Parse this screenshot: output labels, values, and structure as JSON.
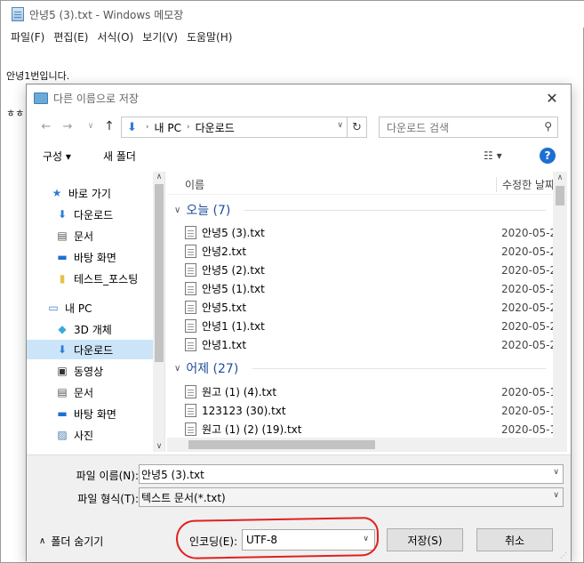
{
  "notepad": {
    "title": "안녕5 (3).txt - Windows 메모장",
    "menu": [
      "파일(F)",
      "편집(E)",
      "서식(O)",
      "보기(V)",
      "도움말(H)"
    ],
    "text_lines": [
      "안녕1번입니다.",
      "ㅎㅎㅎ 반가워요."
    ]
  },
  "dialog": {
    "title": "다른 이름으로 저장",
    "close": "✕",
    "address": {
      "segments": [
        "내 PC",
        "다운로드"
      ]
    },
    "search_placeholder": "다운로드 검색",
    "toolbar": {
      "organize": "구성 ▾",
      "new_folder": "새 폴더",
      "view": "☷ ▾",
      "help": "?"
    },
    "nav_items": [
      {
        "label": "바로 가기",
        "icon": "star-icon"
      },
      {
        "label": "다운로드",
        "icon": "download-icon"
      },
      {
        "label": "문서",
        "icon": "document-icon"
      },
      {
        "label": "바탕 화면",
        "icon": "desktop-icon"
      },
      {
        "label": "테스트_포스팅",
        "icon": "folder-icon"
      },
      {
        "label": "내 PC",
        "icon": "pc-icon"
      },
      {
        "label": "3D 개체",
        "icon": "cube-icon"
      },
      {
        "label": "다운로드",
        "icon": "download-icon",
        "selected": true
      },
      {
        "label": "동영상",
        "icon": "video-icon"
      },
      {
        "label": "문서",
        "icon": "document-icon"
      },
      {
        "label": "바탕 화면",
        "icon": "desktop-icon"
      },
      {
        "label": "사진",
        "icon": "picture-icon"
      }
    ],
    "columns": {
      "name": "이름",
      "date": "수정한 날짜"
    },
    "groups": [
      {
        "label": "오늘 (7)",
        "files": [
          {
            "name": "안녕5 (3).txt",
            "date": "2020-05-2"
          },
          {
            "name": "안녕2.txt",
            "date": "2020-05-2"
          },
          {
            "name": "안녕5 (2).txt",
            "date": "2020-05-2"
          },
          {
            "name": "안녕5 (1).txt",
            "date": "2020-05-2"
          },
          {
            "name": "안녕5.txt",
            "date": "2020-05-2"
          },
          {
            "name": "안녕1 (1).txt",
            "date": "2020-05-2"
          },
          {
            "name": "안녕1.txt",
            "date": "2020-05-2"
          }
        ]
      },
      {
        "label": "어제 (27)",
        "files": [
          {
            "name": "원고 (1) (4).txt",
            "date": "2020-05-1"
          },
          {
            "name": "123123 (30).txt",
            "date": "2020-05-1"
          },
          {
            "name": "원고 (1) (2) (19).txt",
            "date": "2020-05-1"
          }
        ]
      }
    ],
    "filename_label": "파일 이름(N):",
    "filename_value": "안녕5 (3).txt",
    "filetype_label": "파일 형식(T):",
    "filetype_value": "텍스트 문서(*.txt)",
    "hide_folders": "폴더 숨기기",
    "encoding_label": "인코딩(E):",
    "encoding_value": "UTF-8",
    "save_button": "저장(S)",
    "cancel_button": "취소",
    "annotation_color": "#e02020"
  }
}
